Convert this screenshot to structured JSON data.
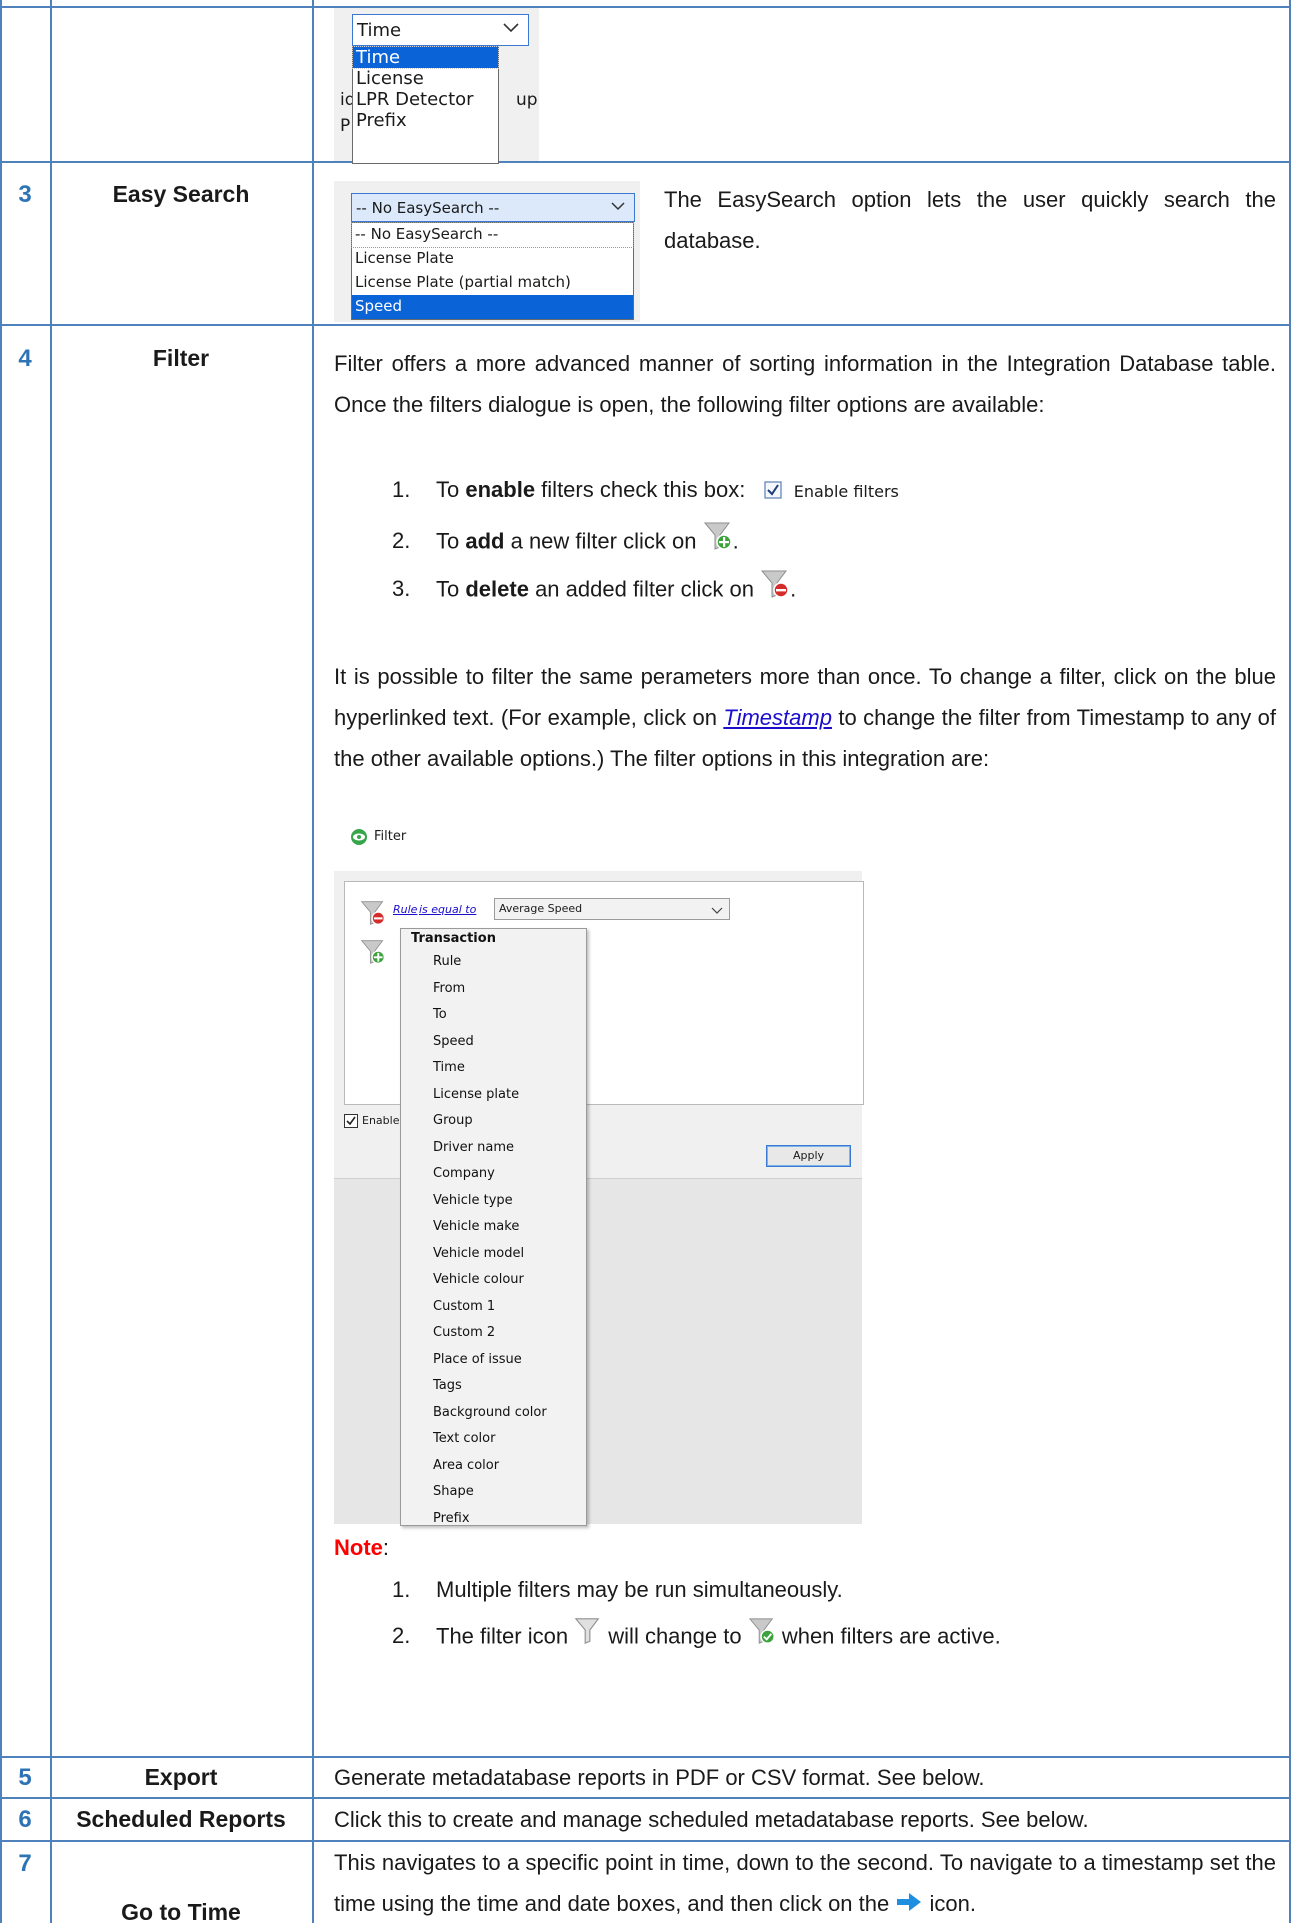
{
  "time_dropdown": {
    "selected": "Time",
    "options": [
      "Time",
      "License",
      "LPR Detector",
      "Prefix"
    ],
    "partial_behind": [
      "id",
      "up",
      "P"
    ]
  },
  "rows": [
    {
      "number": "3",
      "feature": "Easy Search",
      "description": "The EasySearch option lets the user quickly search the database.",
      "easysearch": {
        "selected": "-- No EasySearch --",
        "options": [
          "-- No EasySearch --",
          "License Plate",
          "License Plate (partial match)",
          "Speed"
        ]
      }
    },
    {
      "number": "4",
      "feature": "Filter",
      "intro": "Filter offers a more advanced manner of sorting information in the Integration Database table. Once the filters dialogue is open, the following filter options are available:",
      "steps": [
        {
          "num": "1.",
          "pre": "To ",
          "bold": "enable",
          "post": " filters check this box: "
        },
        {
          "num": "2.",
          "pre": "To ",
          "bold": "add",
          "post": " a new filter click on "
        },
        {
          "num": "3.",
          "pre": "To ",
          "bold": "delete",
          "post": " an added filter click on "
        }
      ],
      "enable_filters_label": "Enable filters",
      "para_pre": "It is possible to filter the same perameters more than once. To change a filter, click on the blue hyperlinked text. (For example, click on ",
      "para_link": "Timestamp",
      "para_post": " to change the filter from Timestamp to any of the other available options.) The filter options in this integration are:",
      "dialog": {
        "title": "Filter",
        "rule_link": "Rule",
        "op_link": "is equal to",
        "value": "Average Speed",
        "enable_partial": "Enable",
        "apply": "Apply",
        "menu_header": "Transaction",
        "menu_items": [
          "Rule",
          "From",
          "To",
          "Speed",
          "Time",
          "License plate",
          "Group",
          "Driver name",
          "Company",
          "Vehicle type",
          "Vehicle make",
          "Vehicle model",
          "Vehicle colour",
          "Custom 1",
          "Custom 2",
          "Place of issue",
          "Tags",
          "Background color",
          "Text color",
          "Area color",
          "Shape",
          "Prefix"
        ]
      },
      "note_label": "Note",
      "note_colon": ":",
      "notes": [
        {
          "num": "1.",
          "text": "Multiple filters may be run simultaneously."
        },
        {
          "num": "2.",
          "pre": "The filter icon ",
          "mid": " will change to ",
          "post": " when filters are active."
        }
      ]
    },
    {
      "number": "5",
      "feature": "Export",
      "description": "Generate metadatabase reports in PDF or CSV format. See below."
    },
    {
      "number": "6",
      "feature": "Scheduled Reports",
      "description": "Click this to create and manage scheduled metadatabase reports. See below."
    },
    {
      "number": "7",
      "feature": "Go to Time",
      "description": "This navigates to a specific point in time, down to the second. To navigate to a timestamp set the time using the time and date boxes, and then click on the ",
      "description_end": " icon."
    }
  ],
  "colors": {
    "border": "#4f81bd",
    "number": "#2e74b5",
    "note": "#ff0000",
    "selection": "#0a64d8",
    "link": "#1a0dcc"
  }
}
